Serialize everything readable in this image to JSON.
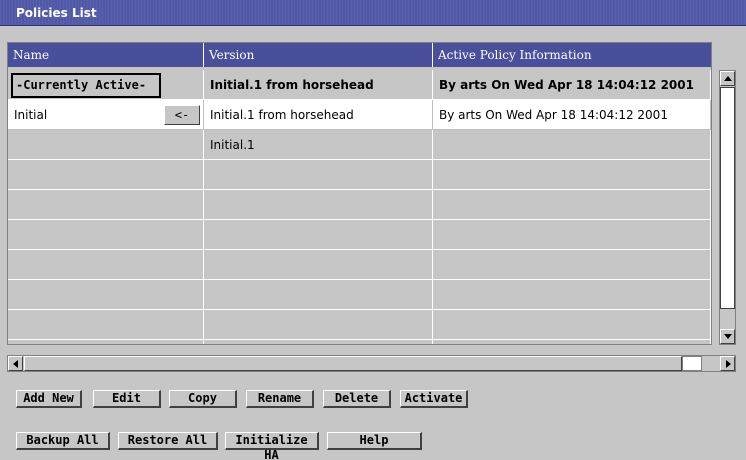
{
  "window": {
    "title": "Policies List"
  },
  "table": {
    "columns": [
      "Name",
      "Version",
      "Active Policy Information"
    ],
    "active_row": {
      "name": "-Currently Active-",
      "version": "Initial.1  from  horsehead",
      "info": "By arts On Wed Apr 18 14:04:12 2001"
    },
    "rows": [
      {
        "name": "Initial",
        "button": "<-",
        "version": "Initial.1  from  horsehead",
        "info": "By arts On Wed Apr 18 14:04:12 2001"
      },
      {
        "name": "",
        "version": "Initial.1",
        "info": ""
      }
    ]
  },
  "buttons_row1": [
    "Add New",
    "Edit",
    "Copy",
    "Rename",
    "Delete",
    "Activate"
  ],
  "buttons_row2": [
    "Backup All",
    "Restore All",
    "Initialize HA",
    "Help"
  ],
  "icons": {
    "scroll_up": "arrow-up-icon",
    "scroll_down": "arrow-down-icon",
    "scroll_left": "arrow-left-icon",
    "scroll_right": "arrow-right-icon"
  },
  "colors": {
    "titlebar": "#5058a8",
    "header": "#4a4f9c",
    "background": "#c6c6c6"
  }
}
